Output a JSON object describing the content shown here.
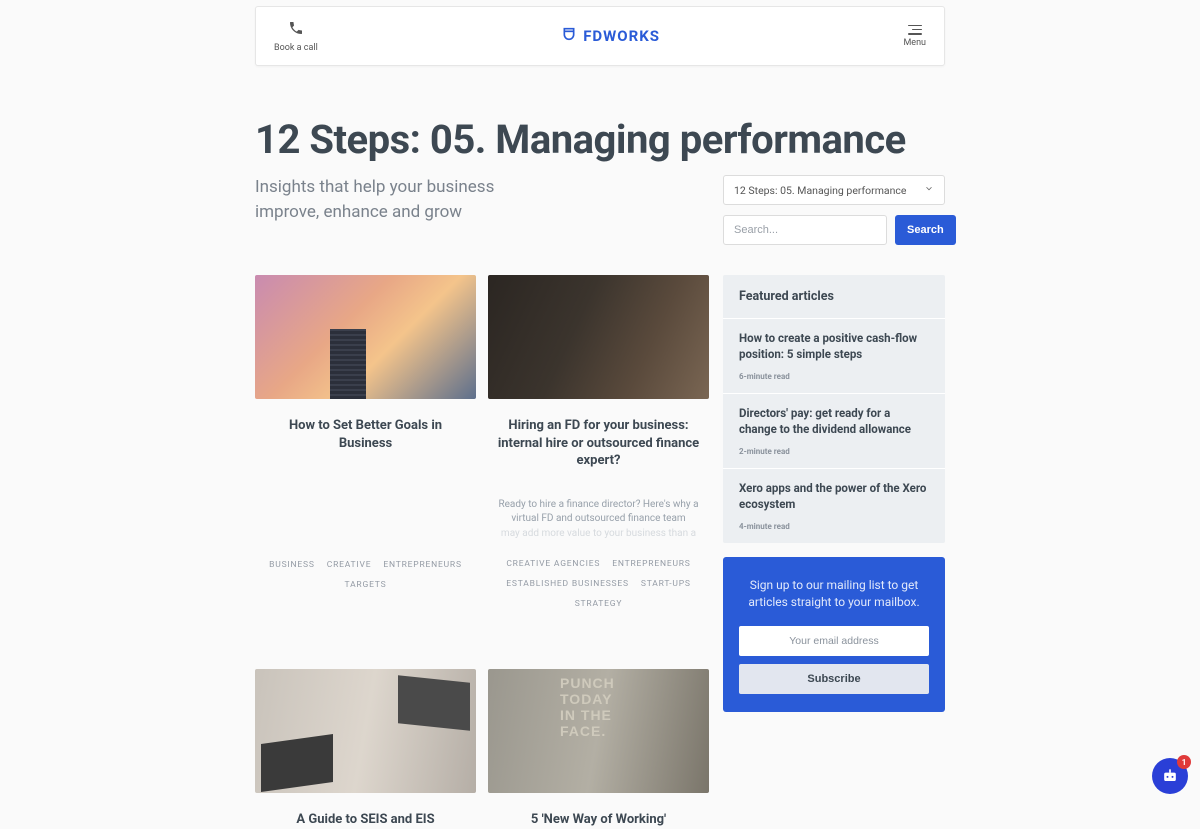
{
  "header": {
    "call_label": "Book a call",
    "logo_text": "FDWORKS",
    "menu_label": "Menu"
  },
  "page": {
    "title": "12 Steps: 05. Managing performance",
    "tagline_l1": "Insights that help your business",
    "tagline_l2": "improve, enhance and grow"
  },
  "filter": {
    "selected": "12 Steps: 05. Managing performance",
    "search_placeholder": "Search...",
    "search_button": "Search"
  },
  "posts": [
    {
      "title": "How to Set Better Goals in Business",
      "tags": [
        "BUSINESS",
        "CREATIVE",
        "ENTREPRENEURS",
        "TARGETS"
      ]
    },
    {
      "title": "Hiring an FD for your business: internal hire or outsourced finance expert?",
      "excerpt_visible": "Ready to hire a finance director? Here's why a virtual FD and outsourced finance team",
      "excerpt_faded": "may add more value to your business than a",
      "tags": [
        "CREATIVE AGENCIES",
        "ENTREPRENEURS",
        "ESTABLISHED BUSINESSES",
        "START-UPS",
        "STRATEGY"
      ]
    },
    {
      "title": "A Guide to SEIS and EIS"
    },
    {
      "title": "5 'New Way of Working'"
    }
  ],
  "sidebar": {
    "featured_heading": "Featured articles",
    "items": [
      {
        "title": "How to create a positive cash-flow position: 5 simple steps",
        "meta": "6-minute read"
      },
      {
        "title": "Directors' pay: get ready for a change to the dividend allowance",
        "meta": "2-minute read"
      },
      {
        "title": "Xero apps and the power of the Xero ecosystem",
        "meta": "4-minute read"
      }
    ],
    "signup_text": "Sign up to our mailing list to get articles straight to your mailbox.",
    "email_placeholder": "Your email address",
    "subscribe_label": "Subscribe"
  },
  "chat": {
    "badge": "1"
  }
}
